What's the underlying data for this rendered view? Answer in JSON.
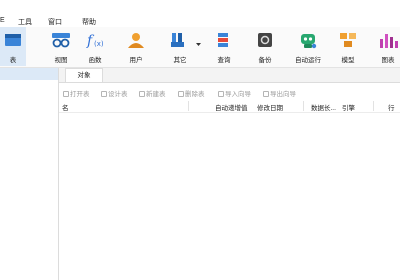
{
  "menu": {
    "items": [
      "E",
      "工具",
      "窗口",
      "帮助"
    ]
  },
  "toolbar": {
    "items": [
      {
        "label": "表",
        "icon": "table-icon",
        "active": true
      },
      {
        "label": "视图",
        "icon": "view-icon"
      },
      {
        "label": "函数",
        "icon": "function-icon"
      },
      {
        "label": "用户",
        "icon": "user-icon"
      },
      {
        "label": "其它",
        "icon": "tools-icon"
      },
      {
        "label": "查询",
        "icon": "query-icon"
      },
      {
        "label": "备份",
        "icon": "backup-icon"
      },
      {
        "label": "自动运行",
        "icon": "robot-icon"
      },
      {
        "label": "模型",
        "icon": "model-icon"
      },
      {
        "label": "图表",
        "icon": "chart-icon"
      }
    ]
  },
  "tabs": {
    "objects": "对象"
  },
  "object_toolbar": {
    "open": "打开表",
    "design": "设计表",
    "new": "新建表",
    "delete": "删除表",
    "import": "导入向导",
    "export": "导出向导"
  },
  "columns": {
    "name": "名",
    "auto_increment": "自动递增值",
    "modified": "修改日期",
    "data_length": "数据长...",
    "engine": "引擎",
    "rows": "行"
  },
  "colors": {
    "accent": "#dce9f7",
    "function": "#2f6fd6",
    "user": "#f0a030",
    "robot": "#28a870",
    "chart": "#c040b0"
  }
}
